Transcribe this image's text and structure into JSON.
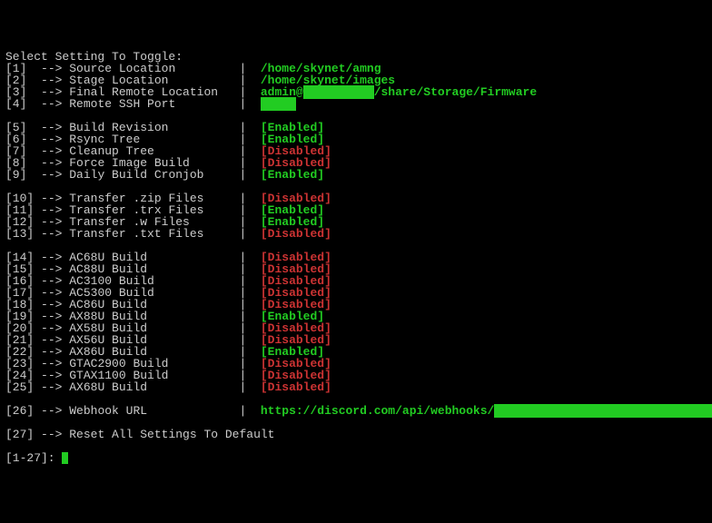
{
  "title": "Select Setting To Toggle:",
  "prompt": "[1-27]: ",
  "groups": [
    {
      "items": [
        {
          "num": "[1]",
          "label": "Source Location",
          "value": "/home/skynet/amng",
          "valueType": "green"
        },
        {
          "num": "[2]",
          "label": "Stage Location",
          "value": "/home/skynet/images",
          "valueType": "green"
        },
        {
          "num": "[3]",
          "label": "Final Remote Location",
          "value_parts": [
            {
              "text": "admin@",
              "type": "green"
            },
            {
              "text": "          ",
              "type": "redacted"
            },
            {
              "text": "/share/Storage/Firmware",
              "type": "green"
            }
          ],
          "valueType": "composite"
        },
        {
          "num": "[4]",
          "label": "Remote SSH Port",
          "value_parts": [
            {
              "text": "     ",
              "type": "redacted"
            }
          ],
          "valueType": "composite"
        }
      ]
    },
    {
      "items": [
        {
          "num": "[5]",
          "label": "Build Revision",
          "value": "[Enabled]",
          "valueType": "green"
        },
        {
          "num": "[6]",
          "label": "Rsync Tree",
          "value": "[Enabled]",
          "valueType": "green"
        },
        {
          "num": "[7]",
          "label": "Cleanup Tree",
          "value": "[Disabled]",
          "valueType": "red"
        },
        {
          "num": "[8]",
          "label": "Force Image Build",
          "value": "[Disabled]",
          "valueType": "red"
        },
        {
          "num": "[9]",
          "label": "Daily Build Cronjob",
          "value": "[Enabled]",
          "valueType": "green"
        }
      ]
    },
    {
      "items": [
        {
          "num": "[10]",
          "label": "Transfer .zip Files",
          "value": "[Disabled]",
          "valueType": "red"
        },
        {
          "num": "[11]",
          "label": "Transfer .trx Files",
          "value": "[Enabled]",
          "valueType": "green"
        },
        {
          "num": "[12]",
          "label": "Transfer .w Files",
          "value": "[Enabled]",
          "valueType": "green"
        },
        {
          "num": "[13]",
          "label": "Transfer .txt Files",
          "value": "[Disabled]",
          "valueType": "red"
        }
      ]
    },
    {
      "items": [
        {
          "num": "[14]",
          "label": "AC68U Build",
          "value": "[Disabled]",
          "valueType": "red"
        },
        {
          "num": "[15]",
          "label": "AC88U Build",
          "value": "[Disabled]",
          "valueType": "red"
        },
        {
          "num": "[16]",
          "label": "AC3100 Build",
          "value": "[Disabled]",
          "valueType": "red"
        },
        {
          "num": "[17]",
          "label": "AC5300 Build",
          "value": "[Disabled]",
          "valueType": "red"
        },
        {
          "num": "[18]",
          "label": "AC86U Build",
          "value": "[Disabled]",
          "valueType": "red"
        },
        {
          "num": "[19]",
          "label": "AX88U Build",
          "value": "[Enabled]",
          "valueType": "green"
        },
        {
          "num": "[20]",
          "label": "AX58U Build",
          "value": "[Disabled]",
          "valueType": "red"
        },
        {
          "num": "[21]",
          "label": "AX56U Build",
          "value": "[Disabled]",
          "valueType": "red"
        },
        {
          "num": "[22]",
          "label": "AX86U Build",
          "value": "[Enabled]",
          "valueType": "green"
        },
        {
          "num": "[23]",
          "label": "GTAC2900 Build",
          "value": "[Disabled]",
          "valueType": "red"
        },
        {
          "num": "[24]",
          "label": "GTAX1100 Build",
          "value": "[Disabled]",
          "valueType": "red"
        },
        {
          "num": "[25]",
          "label": "AX68U Build",
          "value": "[Disabled]",
          "valueType": "red"
        }
      ]
    },
    {
      "items": [
        {
          "num": "[26]",
          "label": "Webhook URL",
          "value_parts": [
            {
              "text": "https://discord.com/api/webhooks/",
              "type": "green"
            },
            {
              "text": "                                 ",
              "type": "redacted"
            }
          ],
          "valueType": "composite"
        }
      ]
    },
    {
      "items": [
        {
          "num": "[27]",
          "label": "Reset All Settings To Default",
          "valueType": "none"
        }
      ]
    }
  ]
}
